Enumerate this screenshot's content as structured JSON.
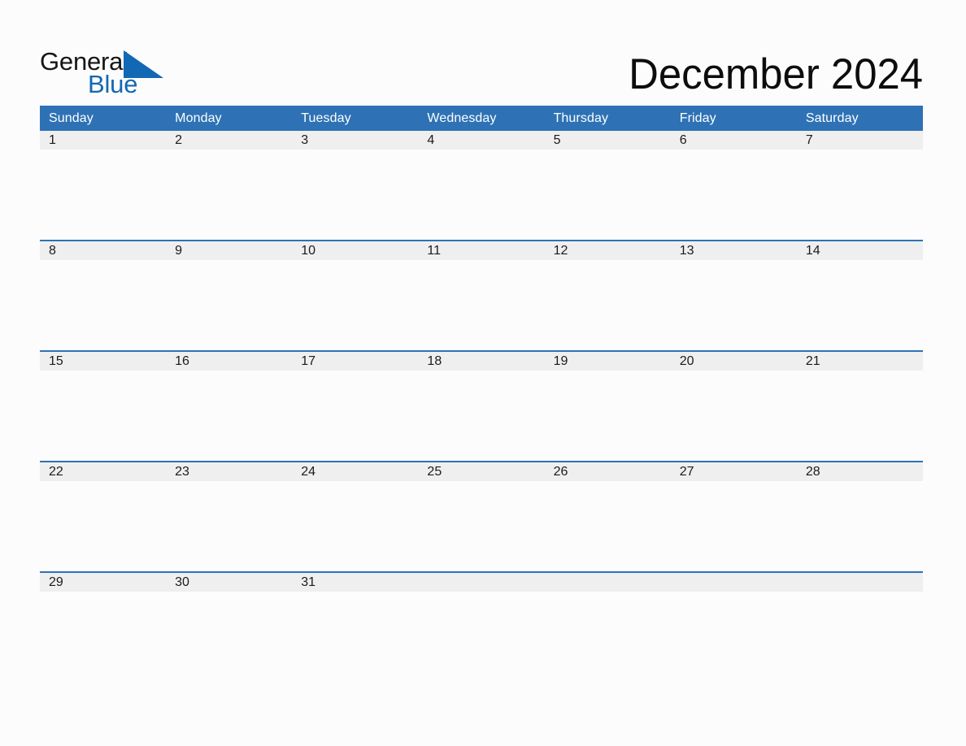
{
  "brand": {
    "name_part1": "General",
    "name_part2": "Blue",
    "triangle_color": "#1268b4",
    "text_color_part1": "#151515",
    "text_color_part2": "#1268b4"
  },
  "header": {
    "title": "December 2024",
    "month": "December",
    "year": "2024"
  },
  "theme": {
    "header_blue": "#2e72b5",
    "date_band_gray": "#efefef",
    "page_background": "#fcfcfc",
    "text_dark": "#1b1b1b",
    "header_text": "#ffffff"
  },
  "calendar": {
    "weekdays": [
      "Sunday",
      "Monday",
      "Tuesday",
      "Wednesday",
      "Thursday",
      "Friday",
      "Saturday"
    ],
    "weeks": [
      {
        "days": [
          {
            "date": "1",
            "events": ""
          },
          {
            "date": "2",
            "events": ""
          },
          {
            "date": "3",
            "events": ""
          },
          {
            "date": "4",
            "events": ""
          },
          {
            "date": "5",
            "events": ""
          },
          {
            "date": "6",
            "events": ""
          },
          {
            "date": "7",
            "events": ""
          }
        ]
      },
      {
        "days": [
          {
            "date": "8",
            "events": ""
          },
          {
            "date": "9",
            "events": ""
          },
          {
            "date": "10",
            "events": ""
          },
          {
            "date": "11",
            "events": ""
          },
          {
            "date": "12",
            "events": ""
          },
          {
            "date": "13",
            "events": ""
          },
          {
            "date": "14",
            "events": ""
          }
        ]
      },
      {
        "days": [
          {
            "date": "15",
            "events": ""
          },
          {
            "date": "16",
            "events": ""
          },
          {
            "date": "17",
            "events": ""
          },
          {
            "date": "18",
            "events": ""
          },
          {
            "date": "19",
            "events": ""
          },
          {
            "date": "20",
            "events": ""
          },
          {
            "date": "21",
            "events": ""
          }
        ]
      },
      {
        "days": [
          {
            "date": "22",
            "events": ""
          },
          {
            "date": "23",
            "events": ""
          },
          {
            "date": "24",
            "events": ""
          },
          {
            "date": "25",
            "events": ""
          },
          {
            "date": "26",
            "events": ""
          },
          {
            "date": "27",
            "events": ""
          },
          {
            "date": "28",
            "events": ""
          }
        ]
      },
      {
        "days": [
          {
            "date": "29",
            "events": ""
          },
          {
            "date": "30",
            "events": ""
          },
          {
            "date": "31",
            "events": ""
          },
          {
            "date": "",
            "events": ""
          },
          {
            "date": "",
            "events": ""
          },
          {
            "date": "",
            "events": ""
          },
          {
            "date": "",
            "events": ""
          }
        ]
      }
    ]
  }
}
